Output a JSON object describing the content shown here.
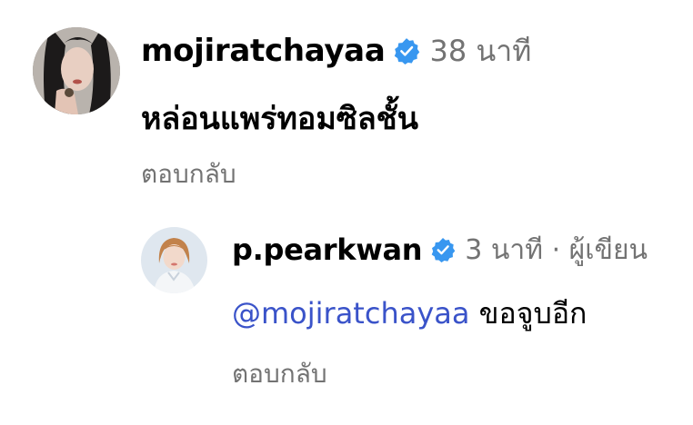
{
  "comments": [
    {
      "username": "mojiratchayaa",
      "verified": true,
      "time": "38 นาที",
      "text": "หล่อนแพร่ทอมซิลชั้น",
      "reply_label": "ตอบกลับ"
    },
    {
      "username": "p.pearkwan",
      "verified": true,
      "time": "3 นาที · ผู้เขียน",
      "mention": "@mojiratchayaa",
      "text": "ขอจูบอีก",
      "reply_label": "ตอบกลับ"
    }
  ],
  "icons": {
    "verified": "verified-badge-icon",
    "avatar": "profile-avatar"
  },
  "colors": {
    "verified_badge": "#3897f0",
    "mention": "#3a53c9",
    "meta_text": "#737373",
    "text": "#000000",
    "background": "#ffffff"
  }
}
